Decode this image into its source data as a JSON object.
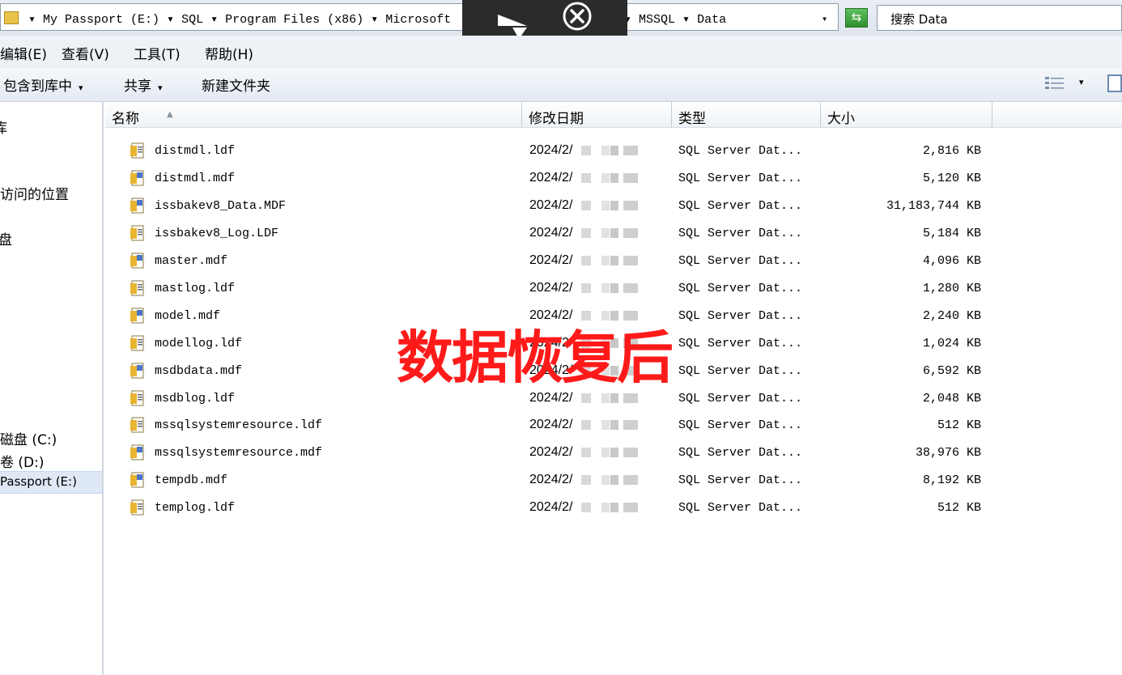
{
  "address": {
    "path_left": "▾ My Passport (E:) ▾ SQL ▾ Program Files (x86) ▾ Microsoft",
    "path_right": "▾ MSSQL ▾ Data",
    "dropdown": "▾",
    "search_placeholder": "搜索 Data"
  },
  "menu": [
    {
      "label": "编辑(E)"
    },
    {
      "label": "查看(V)"
    },
    {
      "label": "工具(T)"
    },
    {
      "label": "帮助(H)"
    }
  ],
  "commands": {
    "include": "包含到库中",
    "share": "共享",
    "new_folder": "新建文件夹",
    "caret": "▾"
  },
  "nav": {
    "items": [
      "库",
      "访问的位置",
      "盘",
      "磁盘 (C:)",
      "卷 (D:)"
    ],
    "selected": "Passport (E:)"
  },
  "columns": {
    "name": "名称",
    "date": "修改日期",
    "type": "类型",
    "size": "大小",
    "sort_arrow": "▲"
  },
  "files": [
    {
      "name": "distmdl.ldf",
      "date": "2024/2/",
      "type": "SQL Server Dat...",
      "size": "2,816 KB",
      "icon": "ldf-icon"
    },
    {
      "name": "distmdl.mdf",
      "date": "2024/2/",
      "type": "SQL Server Dat...",
      "size": "5,120 KB",
      "icon": "mdf-icon"
    },
    {
      "name": "issbakev8_Data.MDF",
      "date": "2024/2/",
      "type": "SQL Server Dat...",
      "size": "31,183,744 KB",
      "icon": "mdf-icon"
    },
    {
      "name": "issbakev8_Log.LDF",
      "date": "2024/2/",
      "type": "SQL Server Dat...",
      "size": "5,184 KB",
      "icon": "ldf-icon"
    },
    {
      "name": "master.mdf",
      "date": "2024/2/",
      "type": "SQL Server Dat...",
      "size": "4,096 KB",
      "icon": "mdf-icon"
    },
    {
      "name": "mastlog.ldf",
      "date": "2024/2/",
      "type": "SQL Server Dat...",
      "size": "1,280 KB",
      "icon": "ldf-icon"
    },
    {
      "name": "model.mdf",
      "date": "2024/2/",
      "type": "SQL Server Dat...",
      "size": "2,240 KB",
      "icon": "mdf-icon"
    },
    {
      "name": "modellog.ldf",
      "date": "2024/2/",
      "type": "SQL Server Dat...",
      "size": "1,024 KB",
      "icon": "ldf-icon"
    },
    {
      "name": "msdbdata.mdf",
      "date": "2024/2/",
      "type": "SQL Server Dat...",
      "size": "6,592 KB",
      "icon": "mdf-icon"
    },
    {
      "name": "msdblog.ldf",
      "date": "2024/2/",
      "type": "SQL Server Dat...",
      "size": "2,048 KB",
      "icon": "ldf-icon"
    },
    {
      "name": "mssqlsystemresource.ldf",
      "date": "2024/2/",
      "type": "SQL Server Dat...",
      "size": "512 KB",
      "icon": "ldf-icon"
    },
    {
      "name": "mssqlsystemresource.mdf",
      "date": "2024/2/",
      "type": "SQL Server Dat...",
      "size": "38,976 KB",
      "icon": "mdf-icon"
    },
    {
      "name": "tempdb.mdf",
      "date": "2024/2/",
      "type": "SQL Server Dat...",
      "size": "8,192 KB",
      "icon": "mdf-icon"
    },
    {
      "name": "templog.ldf",
      "date": "2024/2/",
      "type": "SQL Server Dat...",
      "size": "512 KB",
      "icon": "ldf-icon"
    }
  ],
  "watermark": "数据恢复后",
  "colors": {
    "watermark": "#ff1a1a",
    "refresh": "#3aa53a",
    "folder": "#e8c34a"
  }
}
